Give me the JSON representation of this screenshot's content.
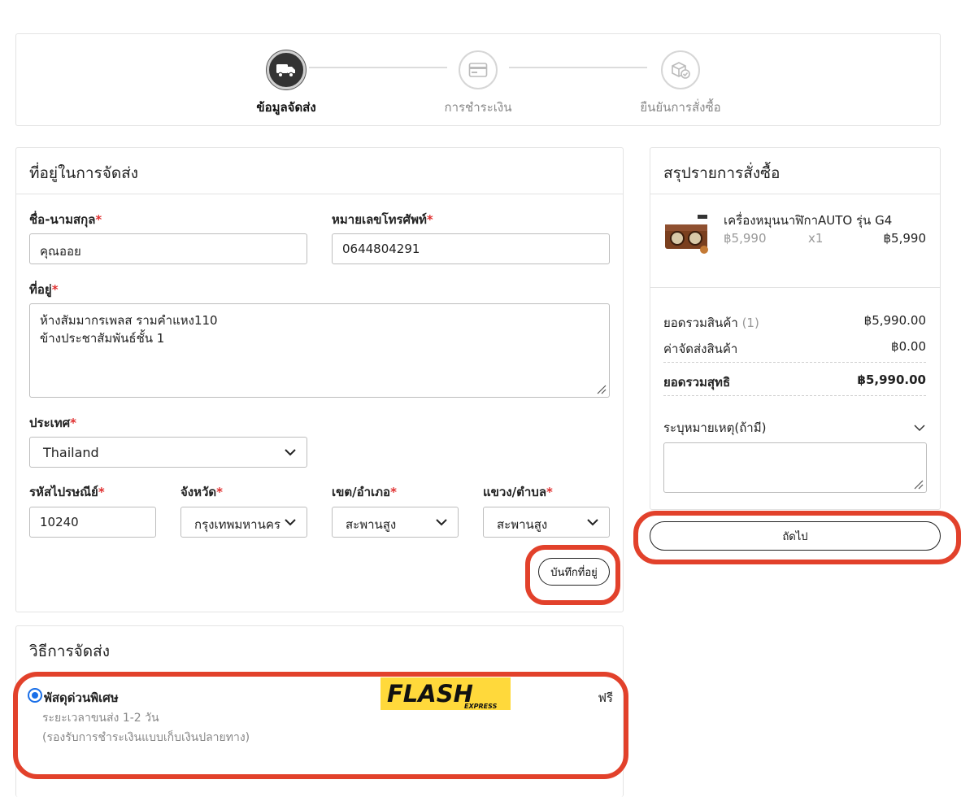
{
  "stepper": {
    "steps": [
      {
        "label": "ข้อมูลจัดส่ง",
        "state": "active",
        "icon": "truck-icon"
      },
      {
        "label": "การชำระเงิน",
        "state": "inactive",
        "icon": "credit-card-icon"
      },
      {
        "label": "ยืนยันการสั่งซื้อ",
        "state": "inactive",
        "icon": "box-check-icon"
      }
    ]
  },
  "address": {
    "title": "ที่อยู่ในการจัดส่ง",
    "name_label": "ชื่อ-นามสกุล",
    "name_value": "คุณออย",
    "phone_label": "หมายเลขโทรศัพท์",
    "phone_value": "0644804291",
    "address_label": "ที่อยู่",
    "address_line1": "ห้างสัมมากรเพลส รามคำแหง110",
    "address_line2": "ข้างประชาสัมพันธ์ชั้น 1",
    "country_label": "ประเทศ",
    "country_value": "Thailand",
    "postcode_label": "รหัสไปรษณีย์",
    "postcode_value": "10240",
    "province_label": "จังหวัด",
    "province_value": "กรุงเทพมหานคร",
    "district_label": "เขต/อำเภอ",
    "district_value": "สะพานสูง",
    "subdistrict_label": "แขวง/ตำบล",
    "subdistrict_value": "สะพานสูง",
    "required_mark": "*",
    "save_label": "บันทึกที่อยู่"
  },
  "shipping": {
    "title": "วิธีการจัดส่ง",
    "option_name": "พัสดุด่วนพิเศษ",
    "option_time": "ระยะเวลาขนส่ง  1-2  วัน",
    "option_note": "(รองรับการชำระเงินแบบเก็บเงินปลายทาง)",
    "option_price": "ฟรี",
    "logo_text": "FLASH",
    "logo_sub": "EXPRESS",
    "accent": "#1a6fe8",
    "logo_bg": "#ffd93b"
  },
  "summary": {
    "title": "สรุปรายการสั่งซื้อ",
    "product_name": "เครื่องหมุนนาฬิกาAUTO รุ่น G4",
    "product_price": "฿5,990",
    "product_qty": "x1",
    "product_total": "฿5,990",
    "subtotal_label": "ยอดรวมสินค้า",
    "subtotal_count": "(1)",
    "subtotal_value": "฿5,990.00",
    "shipping_label": "ค่าจัดส่งสินค้า",
    "shipping_value": "฿0.00",
    "total_label": "ยอดรวมสุทธิ",
    "total_value": "฿5,990.00",
    "note_label": "ระบุหมายเหตุ(ถ้ามี)",
    "next_label": "ถัดไป"
  },
  "highlight_color": "#e2412b"
}
